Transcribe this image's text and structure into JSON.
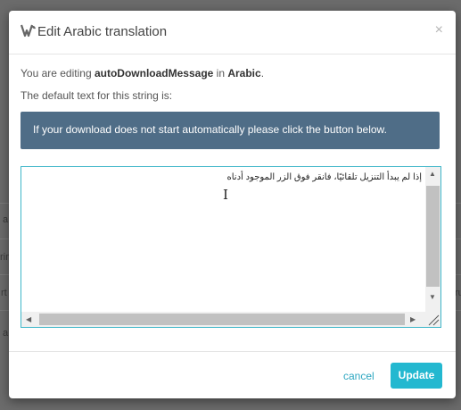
{
  "background": {
    "fragments": [
      "a",
      "rin",
      "rt",
      "ru",
      "a"
    ]
  },
  "modal": {
    "title": "Edit Arabic translation",
    "close": "×",
    "editing_prefix": "You are editing ",
    "string_key": "autoDownloadMessage",
    "editing_middle": " in ",
    "language": "Arabic",
    "editing_suffix": ".",
    "default_label": "The default text for this string is:",
    "default_text": "If your download does not start automatically please click the button below.",
    "translation_value": "إذا لم يبدأ التنزيل تلقائيًا، فانقر فوق الزر الموجود أدناه",
    "cancel_label": "cancel",
    "update_label": "Update"
  },
  "colors": {
    "accent": "#23b8d0",
    "default_box": "#4f6d87",
    "overlay": "#6b6b6b"
  }
}
